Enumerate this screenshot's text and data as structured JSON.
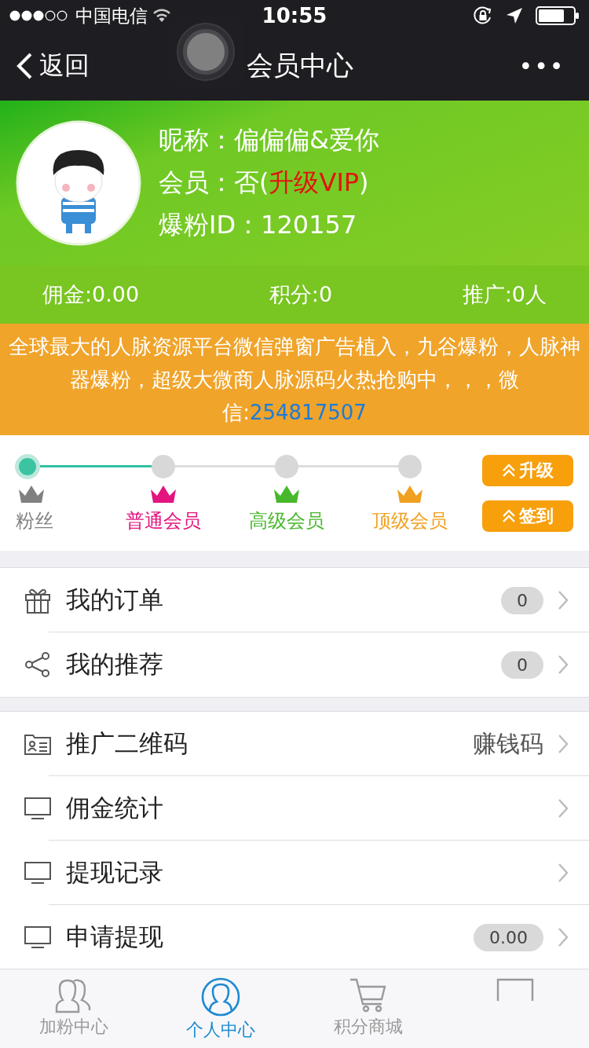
{
  "status_bar": {
    "carrier": "中国电信",
    "time": "10:55"
  },
  "nav": {
    "back": "返回",
    "title": "会员中心",
    "more": "•••"
  },
  "profile": {
    "nickname_label": "昵称：",
    "nickname": "偏偏偏&爱你",
    "member_label": "会员：",
    "member_prefix": "否(",
    "member_link": "升级VIP",
    "member_suffix": ")",
    "id_label": "爆粉ID：",
    "id": "120157"
  },
  "stats": [
    "佣金:0.00",
    "积分:0",
    "推广:0人"
  ],
  "notice": {
    "text": "全球最大的人脉资源平台微信弹窗广告植入，九谷爆粉，人脉神器爆粉，超级大微商人脉源码火热抢购中，，，微信:",
    "link": "254817507"
  },
  "levels": [
    {
      "label": "粉丝",
      "color": "#808080",
      "reached": true
    },
    {
      "label": "普通会员",
      "color": "#e4147f",
      "reached": false
    },
    {
      "label": "高级会员",
      "color": "#47b82c",
      "reached": false
    },
    {
      "label": "顶级会员",
      "color": "#f0a020",
      "reached": false
    }
  ],
  "level_buttons": [
    "升级",
    "签到"
  ],
  "menu_groups": [
    [
      {
        "kind": "gift",
        "label": "我的订单",
        "badge": "0"
      },
      {
        "kind": "share",
        "label": "我的推荐",
        "badge": "0"
      }
    ],
    [
      {
        "kind": "card",
        "label": "推广二维码",
        "value": "赚钱码"
      },
      {
        "kind": "monitor",
        "label": "佣金统计"
      },
      {
        "kind": "monitor",
        "label": "提现记录"
      },
      {
        "kind": "monitor",
        "label": "申请提现",
        "badge": "0.00"
      }
    ]
  ],
  "tabs": [
    {
      "kind": "people",
      "label": "加粉中心",
      "selected": false
    },
    {
      "kind": "person",
      "label": "个人中心",
      "selected": true
    },
    {
      "kind": "cart",
      "label": "积分商城",
      "selected": false
    },
    {
      "kind": "screen",
      "selected": false
    }
  ]
}
